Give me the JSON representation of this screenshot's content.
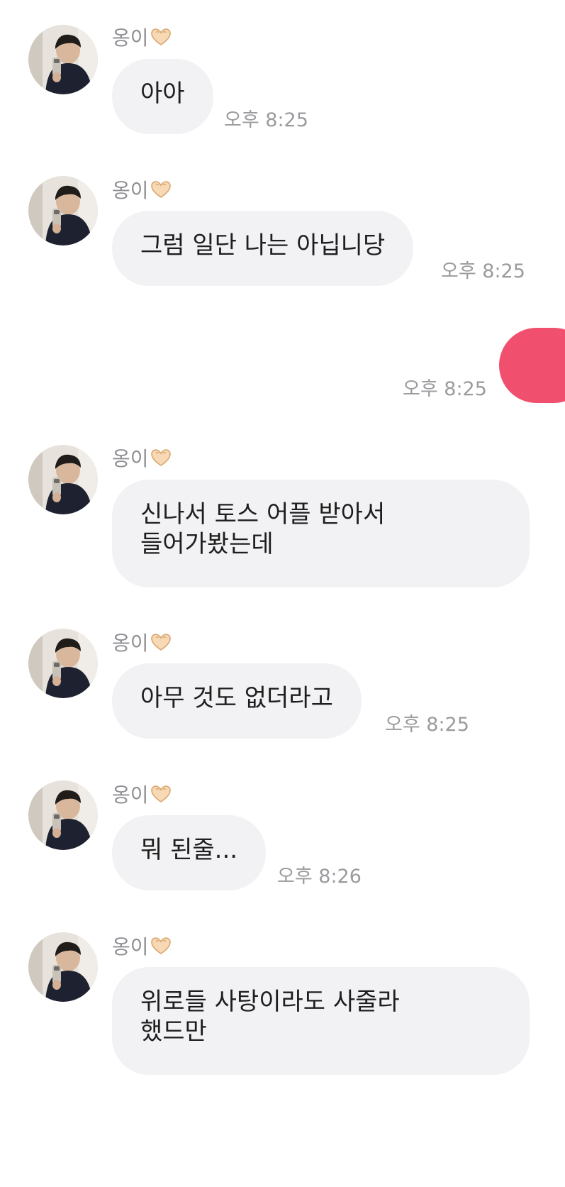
{
  "colors": {
    "incoming_bubble": "#f2f2f4",
    "outgoing_bubble": "#f14f6e",
    "sender_name": "#8e8e93",
    "timestamp": "#9b9b9f",
    "message_text": "#1e1e1e"
  },
  "icons": {
    "sender_suffix": "heart-hands-icon"
  },
  "messages": [
    {
      "sender": "옹이",
      "text": "아아",
      "time": "오후 8:25"
    },
    {
      "sender": "옹이",
      "text": "그럼 일단 나는 아닙니당",
      "time": "오후 8:25"
    },
    {
      "time": "오후 8:25"
    },
    {
      "sender": "옹이",
      "text": "신나서 토스 어플 받아서\n들어가봤는데"
    },
    {
      "sender": "옹이",
      "text": "아무 것도 없더라고",
      "time": "오후 8:25"
    },
    {
      "sender": "옹이",
      "text": "뭐 된줄...",
      "time": "오후 8:26"
    },
    {
      "sender": "옹이",
      "text": "위로들 사탕이라도 사줄라\n했드만"
    }
  ]
}
